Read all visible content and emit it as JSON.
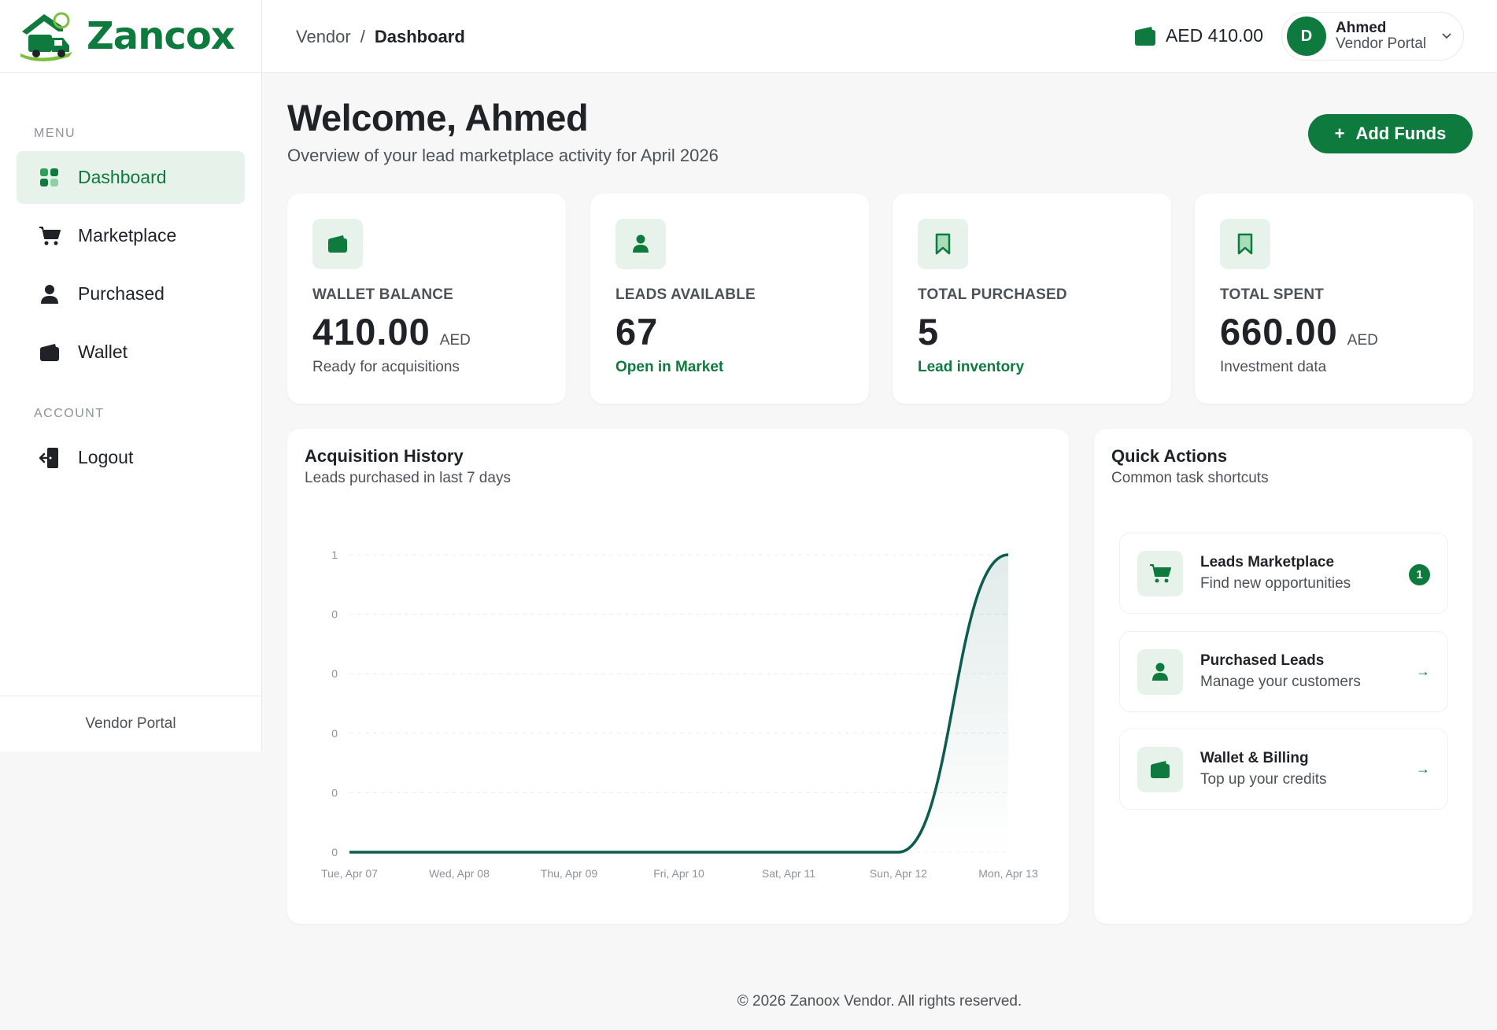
{
  "app": {
    "logo_text": "Zancox"
  },
  "sidebar": {
    "menu_heading": "MENU",
    "account_heading": "ACCOUNT",
    "items": [
      {
        "label": "Dashboard",
        "icon": "grid-icon",
        "active": true
      },
      {
        "label": "Marketplace",
        "icon": "cart-icon"
      },
      {
        "label": "Purchased",
        "icon": "user-icon"
      },
      {
        "label": "Wallet",
        "icon": "wallet-icon"
      }
    ],
    "account_items": [
      {
        "label": "Logout",
        "icon": "logout-icon"
      }
    ],
    "footer": "Vendor Portal"
  },
  "header": {
    "breadcrumb": [
      "Vendor",
      "/",
      "Dashboard"
    ],
    "wallet_amount": "AED 410.00",
    "user": {
      "initial": "D",
      "name": "Ahmed",
      "role": "Vendor Portal"
    }
  },
  "main": {
    "welcome": "Welcome, Ahmed",
    "subtitle": "Overview of your lead marketplace activity for April 2026",
    "add_funds_label": "Add Funds",
    "add_funds_icon": "+",
    "stats": [
      {
        "label": "WALLET BALANCE",
        "value": "410.00",
        "unit": "AED",
        "note": "Ready for acquisitions",
        "note_green": false,
        "icon": "wallet-icon"
      },
      {
        "label": "LEADS AVAILABLE",
        "value": "67",
        "unit": "",
        "note": "Open in Market",
        "note_green": true,
        "icon": "user-icon"
      },
      {
        "label": "TOTAL PURCHASED",
        "value": "5",
        "unit": "",
        "note": "Lead inventory",
        "note_green": true,
        "icon": "bookmark-icon"
      },
      {
        "label": "TOTAL SPENT",
        "value": "660.00",
        "unit": "AED",
        "note": "Investment data",
        "note_green": false,
        "icon": "bookmark-icon"
      }
    ],
    "history": {
      "title": "Acquisition History",
      "subtitle": "Leads purchased in last 7 days"
    },
    "quick_actions": {
      "title": "Quick Actions",
      "subtitle": "Common task shortcuts",
      "items": [
        {
          "title": "Leads Marketplace",
          "subtitle": "Find new opportunities",
          "badge": "1",
          "icon": "cart-icon"
        },
        {
          "title": "Purchased Leads",
          "subtitle": "Manage your customers",
          "arrow": "→",
          "icon": "user-icon"
        },
        {
          "title": "Wallet & Billing",
          "subtitle": "Top up your credits",
          "arrow": "→",
          "icon": "wallet-icon"
        }
      ]
    }
  },
  "footer": {
    "text": "© 2026 Zanoox Vendor. All rights reserved."
  },
  "colors": {
    "brand": "#0f7a3d",
    "line": "#0d5c4f",
    "active_bg": "#e6f2ea"
  },
  "chart_data": {
    "type": "area",
    "title": "Acquisition History",
    "categories": [
      "Tue, Apr 07",
      "Wed, Apr 08",
      "Thu, Apr 09",
      "Fri, Apr 10",
      "Sat, Apr 11",
      "Sun, Apr 12",
      "Mon, Apr 13"
    ],
    "values": [
      0,
      0,
      0,
      0,
      0,
      0,
      1
    ],
    "ytick_labels": [
      "1",
      "0",
      "0",
      "0",
      "0",
      "0"
    ],
    "ylim": [
      0,
      1
    ],
    "grid": true,
    "smooth": true
  }
}
